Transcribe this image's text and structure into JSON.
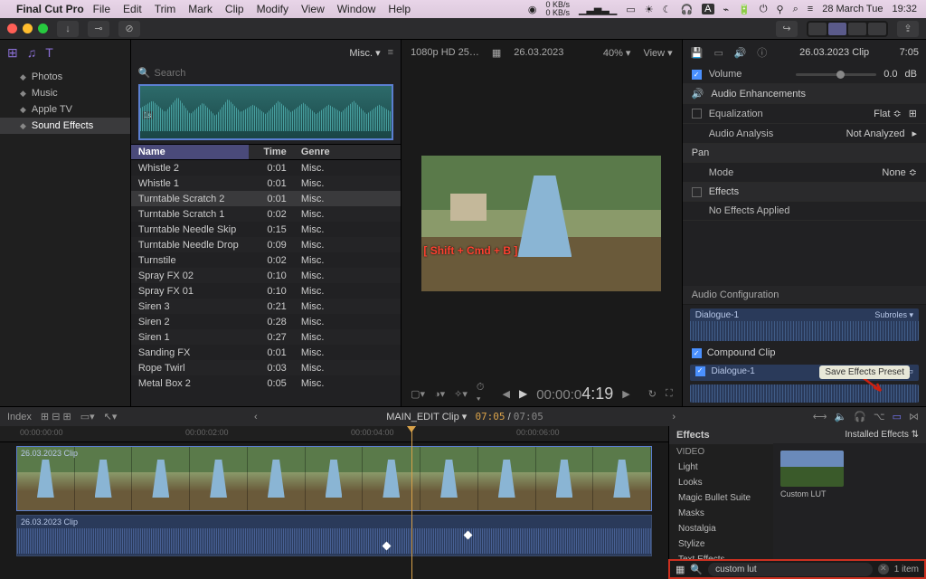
{
  "menubar": {
    "app": "Final Cut Pro",
    "items": [
      "File",
      "Edit",
      "Trim",
      "Mark",
      "Clip",
      "Modify",
      "View",
      "Window",
      "Help"
    ],
    "net_up": "0 KB/s",
    "net_down": "0 KB/s",
    "date": "28 March Tue",
    "time": "19:32"
  },
  "toolbar": {
    "share_icon": "⇪"
  },
  "library": {
    "items": [
      "Photos",
      "Music",
      "Apple TV",
      "Sound Effects"
    ],
    "selected": 3
  },
  "browser": {
    "filter": "Misc.",
    "search_placeholder": "Search",
    "waveform_label": "1s",
    "columns": [
      "Name",
      "Time",
      "Genre"
    ],
    "rows": [
      {
        "name": "Whistle 2",
        "time": "0:01",
        "genre": "Misc."
      },
      {
        "name": "Whistle 1",
        "time": "0:01",
        "genre": "Misc."
      },
      {
        "name": "Turntable Scratch 2",
        "time": "0:01",
        "genre": "Misc.",
        "sel": true
      },
      {
        "name": "Turntable Scratch 1",
        "time": "0:02",
        "genre": "Misc."
      },
      {
        "name": "Turntable Needle Skip",
        "time": "0:15",
        "genre": "Misc."
      },
      {
        "name": "Turntable Needle Drop",
        "time": "0:09",
        "genre": "Misc."
      },
      {
        "name": "Turnstile",
        "time": "0:02",
        "genre": "Misc."
      },
      {
        "name": "Spray FX 02",
        "time": "0:10",
        "genre": "Misc."
      },
      {
        "name": "Spray FX 01",
        "time": "0:10",
        "genre": "Misc."
      },
      {
        "name": "Siren 3",
        "time": "0:21",
        "genre": "Misc."
      },
      {
        "name": "Siren 2",
        "time": "0:28",
        "genre": "Misc."
      },
      {
        "name": "Siren 1",
        "time": "0:27",
        "genre": "Misc."
      },
      {
        "name": "Sanding FX",
        "time": "0:01",
        "genre": "Misc."
      },
      {
        "name": "Rope Twirl",
        "time": "0:03",
        "genre": "Misc."
      },
      {
        "name": "Metal Box 2",
        "time": "0:05",
        "genre": "Misc."
      }
    ]
  },
  "viewer": {
    "format": "1080p HD 25…",
    "date": "26.03.2023",
    "zoom": "40%",
    "view_label": "View",
    "overlay_text": "[ Shift + Cmd + B ]",
    "tc_small": "00:00:0",
    "tc_big": "4:19"
  },
  "inspector": {
    "title": "26.03.2023 Clip",
    "duration": "7:05",
    "volume": {
      "label": "Volume",
      "value": "0.0",
      "unit": "dB"
    },
    "audio_enh": "Audio Enhancements",
    "eq": {
      "label": "Equalization",
      "value": "Flat"
    },
    "analysis": {
      "label": "Audio Analysis",
      "value": "Not Analyzed"
    },
    "pan": {
      "label": "Pan",
      "mode_label": "Mode",
      "mode_value": "None"
    },
    "effects": {
      "label": "Effects",
      "empty": "No Effects Applied"
    },
    "audio_conf": "Audio Configuration",
    "dialogue": {
      "name": "Dialogue-1",
      "sub": "Subroles"
    },
    "compound": "Compound Clip",
    "dialogue2": "Dialogue-1",
    "tooltip": "Save Effects Preset"
  },
  "timeline": {
    "index_label": "Index",
    "title": "MAIN_EDIT Clip",
    "tc_current": "07:05",
    "tc_total": "07:05",
    "ruler": [
      "00:00:00:00",
      "00:00:02:00",
      "00:00:04:00",
      "00:00:06:00"
    ],
    "clip_label": "26.03.2023 Clip"
  },
  "effects": {
    "header": "Effects",
    "installed": "Installed Effects",
    "video_label": "VIDEO",
    "cats": [
      "Light",
      "Looks",
      "Magic Bullet Suite",
      "Masks",
      "Nostalgia",
      "Stylize",
      "Text Effects"
    ],
    "thumb_label": "Custom LUT",
    "search_value": "custom lut",
    "count": "1 item"
  }
}
